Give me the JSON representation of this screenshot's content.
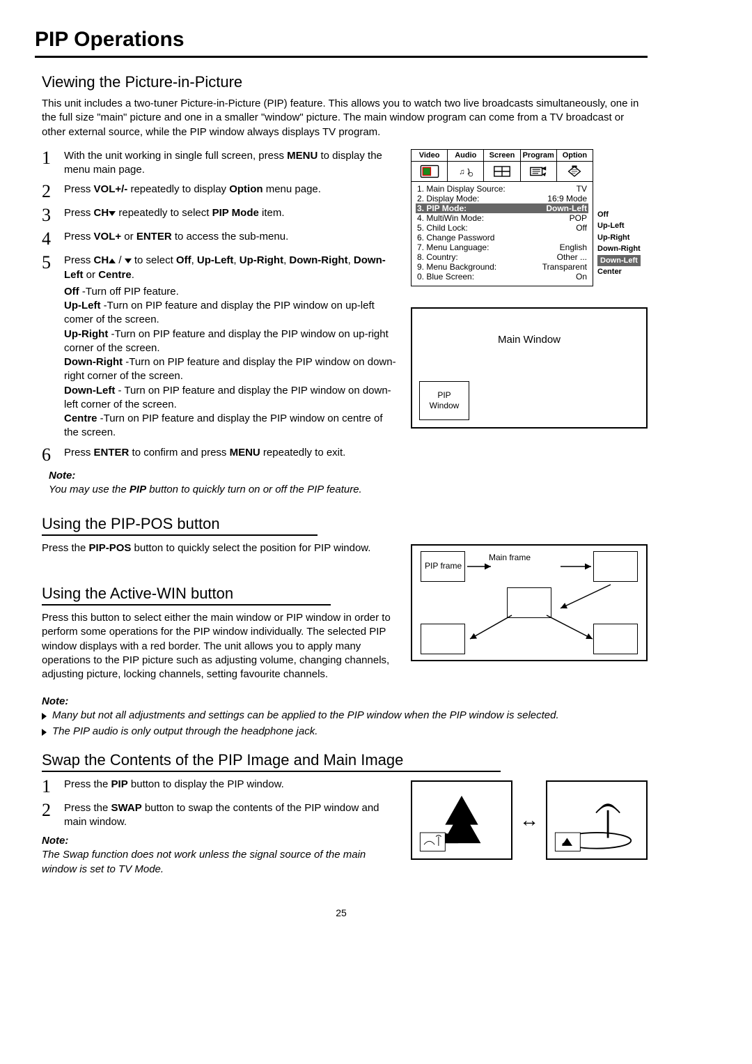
{
  "title": "PIP Operations",
  "section1": {
    "heading": "Viewing the Picture-in-Picture",
    "intro": "This unit includes a two-tuner Picture-in-Picture (PIP) feature. This allows you to watch two live broadcasts simultaneously, one in the full size \"main\" picture and one in a smaller \"window\" picture. The main window program can come from a TV broadcast or other external source, while the PIP window always displays TV program."
  },
  "steps": [
    {
      "num": "1",
      "pre": "With the unit working in single full screen, press ",
      "b": "MENU",
      "post": " to display the menu main page."
    },
    {
      "num": "2",
      "pre": "Press ",
      "b": "VOL+/-",
      "post": " repeatedly to display ",
      "b2": "Option",
      "post2": " menu page."
    },
    {
      "num": "3",
      "pre": "Press ",
      "b": "CH",
      "tri": "down",
      "post": " repeatedly to select ",
      "b2": "PIP Mode",
      "post2": " item."
    },
    {
      "num": "4",
      "pre": "Press ",
      "b": "VOL+",
      "post": " or ",
      "b2": "ENTER",
      "post2": " to access the sub-menu."
    },
    {
      "num": "5",
      "pre": "Press ",
      "b": "CH",
      "tri": "updown",
      "post": " to select ",
      "b2": "Off",
      "c2": ", ",
      "b3": "Up-Left",
      "c3": ", ",
      "b4": "Up-Right",
      "c4": ", ",
      "b5": "Down-Right",
      "c5": ", ",
      "b6": "Down-Left",
      "c6": " or ",
      "b7": "Centre",
      "c7": "."
    }
  ],
  "step5sub": [
    {
      "b": "Off",
      "t": " -Turn off PIP feature."
    },
    {
      "b": "Up-Left",
      "t": " -Turn on PIP feature and display the PIP window on up-left comer of the screen."
    },
    {
      "b": "Up-Right",
      "t": " -Turn on PIP feature and display the PIP window on up-right corner of the screen."
    },
    {
      "b": "Down-Right",
      "t": " -Turn on PIP feature and display the PIP window on down-right corner of the screen."
    },
    {
      "b": "Down-Left",
      "t": " - Turn on PIP feature and display the PIP window on down-left corner of the screen."
    },
    {
      "b": "Centre",
      "t": " -Turn on PIP feature and display the PIP window on centre of the screen."
    }
  ],
  "step6": {
    "num": "6",
    "pre": "Press ",
    "b": "ENTER",
    "post": " to confirm and press ",
    "b2": "MENU",
    "post2": " repeatedly to exit."
  },
  "note1": {
    "label": "Note:",
    "body_pre": "You may use the ",
    "body_b": "PIP",
    "body_post": " button to quickly turn on or off the PIP feature."
  },
  "osd": {
    "tabs": [
      "Video",
      "Audio",
      "Screen",
      "Program",
      "Option"
    ],
    "rows": [
      {
        "l": "1. Main Display Source:",
        "r": "TV"
      },
      {
        "l": "2. Display Mode:",
        "r": "16:9 Mode"
      },
      {
        "l": "3. PIP Mode:",
        "r": "Down-Left",
        "hl": true
      },
      {
        "l": "4. MultiWin Mode:",
        "r": "POP"
      },
      {
        "l": "5. Child Lock:",
        "r": "Off"
      },
      {
        "l": "6. Change Password",
        "r": ""
      },
      {
        "l": "7. Menu Language:",
        "r": "English"
      },
      {
        "l": "8. Country:",
        "r": "Other ..."
      },
      {
        "l": "9. Menu Background:",
        "r": "Transparent"
      },
      {
        "l": "0. Blue Screen:",
        "r": "On"
      }
    ],
    "side": [
      "Off",
      "Up-Left",
      "Up-Right",
      "Down-Right",
      "Down-Left",
      "Center"
    ],
    "side_hl_index": 4
  },
  "pipDiagram": {
    "main": "Main Window",
    "pip": "PIP\nWindow"
  },
  "section2": {
    "heading": "Using the PIP-POS button",
    "body_pre": "Press the ",
    "body_b": "PIP-POS",
    "body_post": " button to quickly select the position for PIP window."
  },
  "posDiagram": {
    "main": "Main frame",
    "pip": "PIP frame"
  },
  "section3": {
    "heading": "Using the Active-WIN button",
    "body": "Press this button to select either the main window or PIP window in order to perform some operations for the PIP window individually. The selected PIP window displays with a red border. The unit allows you to apply many operations to the PIP picture such as adjusting volume, changing channels, adjusting picture, locking channels, setting favourite channels."
  },
  "note2": {
    "label": "Note:",
    "items": [
      "Many but not all adjustments and settings can be applied to the PIP window when the PIP window is selected.",
      "The PIP audio is only output through the headphone jack."
    ]
  },
  "section4": {
    "heading": "Swap the Contents of the PIP Image and Main Image"
  },
  "swapSteps": [
    {
      "num": "1",
      "pre": "Press the ",
      "b": "PIP",
      "post": " button to display the PIP window."
    },
    {
      "num": "2",
      "pre": "Press the ",
      "b": "SWAP",
      "post": " button to swap the contents of the PIP window and main window."
    }
  ],
  "note3": {
    "label": "Note:",
    "body": "The Swap function does not work unless the signal source of the main window is set to TV Mode."
  },
  "pageNumber": "25"
}
